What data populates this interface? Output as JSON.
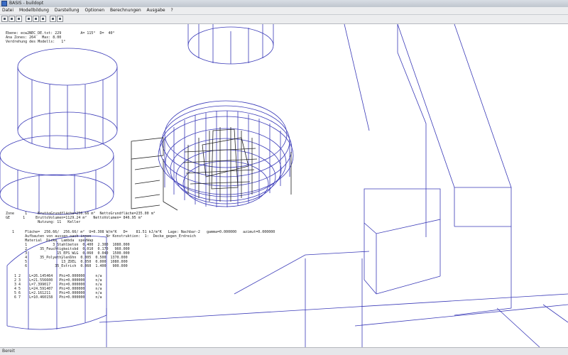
{
  "window": {
    "title": "BASIS - buildopt"
  },
  "menu": [
    "Datei",
    "Modellbildung",
    "Darstellung",
    "Optionen",
    "Berechnungen",
    "Ausgabe",
    "?"
  ],
  "toolbar": {
    "icons": [
      "new-file-icon",
      "open-folder-icon",
      "save-icon",
      "cut-icon",
      "copy-icon",
      "paste-icon",
      "print-icon",
      "help-icon"
    ]
  },
  "info": {
    "line1": "Ebene: ecw2NEC_DE.txt: 229         A= 115°  D=  40°",
    "line2": "Ana Zones: 264   Max: 8.00",
    "line3": "Verdrehung des Modells:   1°"
  },
  "zone": {
    "row1": "Zone     1     BruttoGrundfläche=256.66 m²  NettoGrundfläche=235.00 m²",
    "row2": "GE      1     BruttoVolumen=1129.24 m²   NettoVolumen= 846.95 m²",
    "row3": "               Nutzung: 11   Keller"
  },
  "element": {
    "row1": "   1     Fläche=  256.66/  256.66/ m²  U=0.308 W/m²K   D=    81.51 kJ/m²K   Lage: Nachbar-2   gamma=0.000000   azimut=0.000000",
    "row2": "         Aufbauten von aussen nach innen       Nr Konstruktion:  1:  Decke_gegen_Erdreich",
    "header": "         Material  Dicke  Lambda  spezWap"
  },
  "materials": [
    "         1            3_Stahlbeton  0.400  2.300  1080.000",
    "         2      35_Feuchtigkeitsbd  0.010  0.170   960.000",
    "         3              15_EPS_WLG  0.060  0.040  1500.000",
    "         4      35_Polyethylenbhn  0.005  0.500  1370.000",
    "         5                13_ZDEL  0.050  0.000  1080.000",
    "         6             35_Estrich  0.060  1.400   900.000"
  ],
  "coords": [
    "    1 2    L=26.145464   Phi=0.000000     n/a",
    "    2 3    L=21.556600   Phi=0.000000     n/a",
    "    3 4    L=7.399017    Phi=0.000000     n/a",
    "    4 5    L=24.591407   Phi=0.000000     n/a",
    "    5 6    L=2.161211    Phi=0.000000     n/a",
    "    6 7    L=10.460158   Phi=0.000000     n/a"
  ],
  "status": {
    "text": "Bereit"
  },
  "colors": {
    "wire_blue": "#3a3ab8",
    "wire_black": "#222222"
  }
}
